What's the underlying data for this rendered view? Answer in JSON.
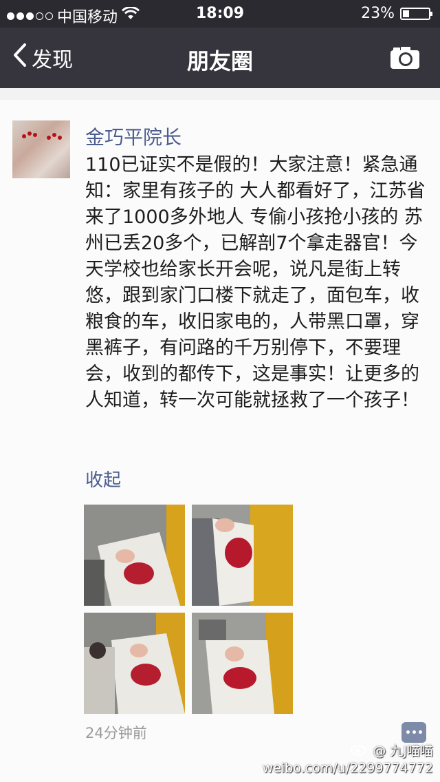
{
  "status_bar": {
    "carrier": "中国移动",
    "time": "18:09",
    "battery": "23%",
    "battery_level": 0.23,
    "signal_bars_filled": 3,
    "signal_bars_total": 5
  },
  "nav": {
    "back_label": "发现",
    "title": "朋友圈",
    "right_icon": "camera-icon"
  },
  "post": {
    "author": "金巧平院长",
    "text": "110已证实不是假的！大家注意！紧急通知：家里有孩子的 大人都看好了，江苏省来了1000多外地人 专偷小孩抢小孩的 苏州已丢20多个，已解剖7个拿走器官！今天学校也给家长开会呢，说凡是街上转悠，跟到家门口楼下就走了，面包车，收粮食的车，收旧家电的，人带黑口罩，穿黑裤子，有问路的千万别停下，不要理会，收到的都传下，这是事实！让更多的人知道，转一次可能就拯救了一个孩子！",
    "collapse_label": "收起",
    "time_ago": "24分钟前",
    "photo_count": 4
  },
  "watermark": {
    "user": "@ 九J喵喵",
    "url": "weibo.com/u/2299774772"
  },
  "colors": {
    "status_bg": "#2b2a30",
    "nav_bg": "#36343c",
    "name_link": "#4b5c8f",
    "body_text": "#1d1d1d"
  }
}
